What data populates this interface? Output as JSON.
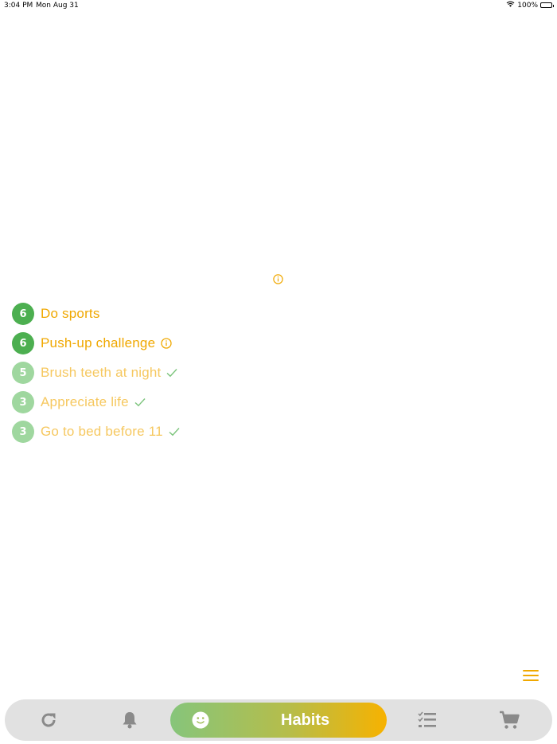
{
  "status_bar": {
    "time": "3:04 PM",
    "date": "Mon Aug 31",
    "battery": "100%",
    "battery_level": 1.0
  },
  "habits": [
    {
      "count": "6",
      "label": "Do sports",
      "state": "active",
      "suffix": "none"
    },
    {
      "count": "6",
      "label": "Push-up challenge",
      "state": "active",
      "suffix": "info-icon"
    },
    {
      "count": "5",
      "label": "Brush teeth at night",
      "state": "done",
      "suffix": "check-icon"
    },
    {
      "count": "3",
      "label": "Appreciate life",
      "state": "done",
      "suffix": "check-icon"
    },
    {
      "count": "3",
      "label": "Go to bed before 11",
      "state": "done",
      "suffix": "check-icon"
    }
  ],
  "tab_bar": {
    "active_label": "Habits",
    "tabs": [
      "refresh-icon",
      "bell-icon",
      "smile-icon",
      "checklist-icon",
      "cart-icon"
    ]
  },
  "colors": {
    "accent_orange": "#f0a800",
    "accent_orange_light": "#f6c860",
    "badge_active": "#4caf50",
    "badge_done": "#9fd79f",
    "check_green": "#7cc47c",
    "tab_bar_bg": "#e1e1e1",
    "tab_icon": "#8a8a8a"
  }
}
